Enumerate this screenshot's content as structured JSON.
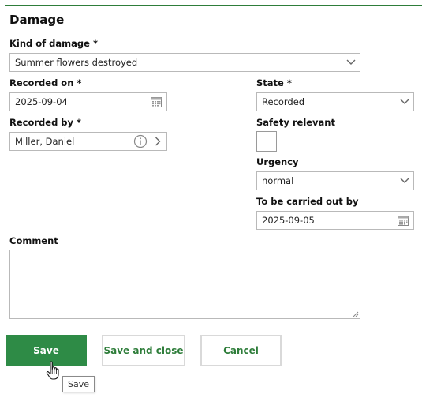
{
  "form": {
    "title": "Damage",
    "kind_of_damage": {
      "label": "Kind of damage *",
      "value": "Summer flowers destroyed"
    },
    "recorded_on": {
      "label": "Recorded on *",
      "value": "2025-09-04"
    },
    "recorded_by": {
      "label": "Recorded by *",
      "value": "Miller, Daniel"
    },
    "state": {
      "label": "State *",
      "value": "Recorded"
    },
    "safety_relevant": {
      "label": "Safety relevant",
      "checked": false
    },
    "urgency": {
      "label": "Urgency",
      "value": "normal"
    },
    "carried_out_by": {
      "label": "To be carried out by",
      "value": "2025-09-05"
    },
    "comment": {
      "label": "Comment",
      "value": ""
    }
  },
  "actions": {
    "save": "Save",
    "save_and_close": "Save and close",
    "cancel": "Cancel"
  },
  "tooltip": {
    "text": "Save"
  },
  "icons": {
    "dropdown": "chevron-down-icon",
    "calendar": "calendar-icon",
    "info": "info-icon",
    "navigate": "chevron-right-icon",
    "cursor": "hand-pointer-icon"
  },
  "colors": {
    "accent": "#2e7d3a",
    "primary_button": "#2e8b46",
    "border": "#b9b9b9"
  }
}
